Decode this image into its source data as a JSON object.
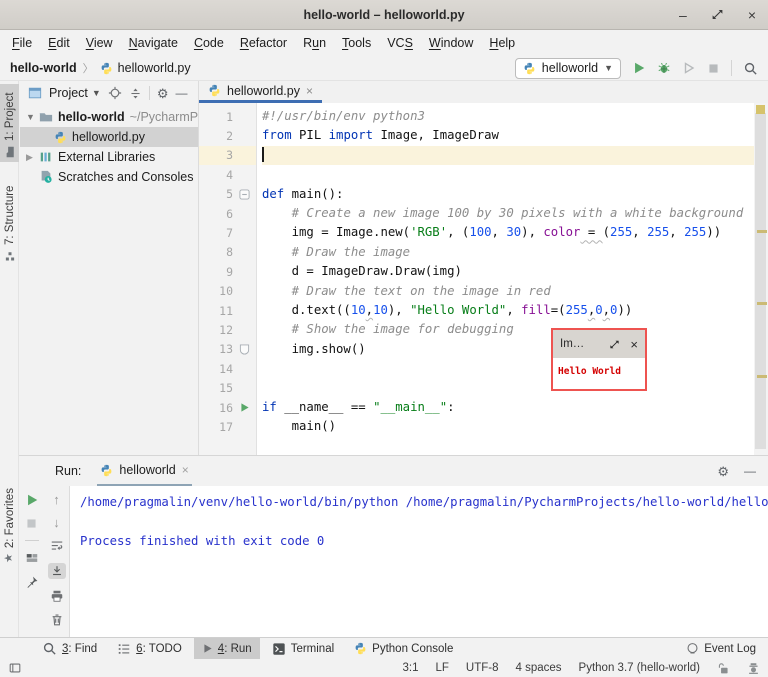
{
  "window": {
    "title": "hello-world – helloworld.py"
  },
  "menu": {
    "items": [
      {
        "label": "File",
        "u": 0
      },
      {
        "label": "Edit",
        "u": 0
      },
      {
        "label": "View",
        "u": 0
      },
      {
        "label": "Navigate",
        "u": 0
      },
      {
        "label": "Code",
        "u": 0
      },
      {
        "label": "Refactor",
        "u": 0
      },
      {
        "label": "Run",
        "u": 1
      },
      {
        "label": "Tools",
        "u": 0
      },
      {
        "label": "VCS",
        "u": 2
      },
      {
        "label": "Window",
        "u": 0
      },
      {
        "label": "Help",
        "u": 0
      }
    ]
  },
  "navbar": {
    "breadcrumb_project": "hello-world",
    "breadcrumb_file": "helloworld.py",
    "run_config": "helloworld"
  },
  "left_strip": {
    "project_tab": "1: Project",
    "structure_tab": "7: Structure",
    "favorites_tab": "2: Favorites"
  },
  "project_panel": {
    "title": "Project",
    "tree": [
      {
        "arrow": "down",
        "icon": "folder",
        "label": "hello-world",
        "suffix": "~/PycharmPr",
        "bold": true,
        "child": false,
        "selected": false
      },
      {
        "arrow": "",
        "icon": "python",
        "label": "helloworld.py",
        "suffix": "",
        "bold": false,
        "child": true,
        "selected": true
      },
      {
        "arrow": "right",
        "icon": "library",
        "label": "External Libraries",
        "suffix": "",
        "bold": false,
        "child": false,
        "selected": false
      },
      {
        "arrow": "",
        "icon": "scratches",
        "label": "Scratches and Consoles",
        "suffix": "",
        "bold": false,
        "child": false,
        "selected": false
      }
    ]
  },
  "editor": {
    "tab_label": "helloworld.py",
    "lines": [
      {
        "n": 1,
        "tokens": [
          [
            "com",
            "#!/usr/bin/env python3"
          ]
        ]
      },
      {
        "n": 2,
        "tokens": [
          [
            "kw",
            "from"
          ],
          [
            "pl",
            " PIL "
          ],
          [
            "kw",
            "import"
          ],
          [
            "pl",
            " Image, ImageDraw"
          ]
        ]
      },
      {
        "n": 3,
        "tokens": [],
        "cursor": true,
        "highlight": true
      },
      {
        "n": 4,
        "tokens": []
      },
      {
        "n": 5,
        "tokens": [
          [
            "kw",
            "def"
          ],
          [
            "pl",
            " main():"
          ]
        ],
        "fold": "minus"
      },
      {
        "n": 6,
        "tokens": [
          [
            "pl",
            "    "
          ],
          [
            "com",
            "# Create a new image 100 by 30 pixels with a white background"
          ]
        ]
      },
      {
        "n": 7,
        "tokens": [
          [
            "pl",
            "    img = Image.new("
          ],
          [
            "str",
            "'RGB'"
          ],
          [
            "pl",
            ", ("
          ],
          [
            "num",
            "100"
          ],
          [
            "pl",
            ", "
          ],
          [
            "num",
            "30"
          ],
          [
            "pl",
            "), "
          ],
          [
            "par",
            "color"
          ],
          [
            "wv",
            " = "
          ],
          [
            "pl",
            "("
          ],
          [
            "num",
            "255"
          ],
          [
            "pl",
            ", "
          ],
          [
            "num",
            "255"
          ],
          [
            "pl",
            ", "
          ],
          [
            "num",
            "255"
          ],
          [
            "pl",
            "))"
          ]
        ]
      },
      {
        "n": 8,
        "tokens": [
          [
            "pl",
            "    "
          ],
          [
            "com",
            "# Draw the image"
          ]
        ]
      },
      {
        "n": 9,
        "tokens": [
          [
            "pl",
            "    d = ImageDraw.Draw(img)"
          ]
        ]
      },
      {
        "n": 10,
        "tokens": [
          [
            "pl",
            "    "
          ],
          [
            "com",
            "# Draw the text on the image in red"
          ]
        ]
      },
      {
        "n": 11,
        "tokens": [
          [
            "pl",
            "    d.text(("
          ],
          [
            "num",
            "10"
          ],
          [
            "wv",
            ","
          ],
          [
            "num",
            "10"
          ],
          [
            "pl",
            "), "
          ],
          [
            "str",
            "\"Hello World\""
          ],
          [
            "pl",
            ", "
          ],
          [
            "par",
            "fill"
          ],
          [
            "pl",
            "=("
          ],
          [
            "num",
            "255"
          ],
          [
            "wv",
            ","
          ],
          [
            "num",
            "0"
          ],
          [
            "wv",
            ","
          ],
          [
            "num",
            "0"
          ],
          [
            "pl",
            "))"
          ]
        ]
      },
      {
        "n": 12,
        "tokens": [
          [
            "pl",
            "    "
          ],
          [
            "com",
            "# Show the image for debugging"
          ]
        ]
      },
      {
        "n": 13,
        "tokens": [
          [
            "pl",
            "    img.show()"
          ]
        ],
        "fold": "end"
      },
      {
        "n": 14,
        "tokens": []
      },
      {
        "n": 15,
        "tokens": []
      },
      {
        "n": 16,
        "tokens": [
          [
            "kw",
            "if"
          ],
          [
            "pl",
            " __name__ == "
          ],
          [
            "str",
            "\"__main__\""
          ],
          [
            "pl",
            ":"
          ]
        ],
        "run": true
      },
      {
        "n": 17,
        "tokens": [
          [
            "pl",
            "    main()"
          ]
        ]
      }
    ]
  },
  "popup": {
    "title": "Im…",
    "text": "Hello World"
  },
  "run_panel": {
    "label": "Run:",
    "tab_label": "helloworld",
    "console": [
      "/home/pragmalin/venv/hello-world/bin/python /home/pragmalin/PycharmProjects/hello-world/helloworld.py",
      "",
      "Process finished with exit code 0"
    ]
  },
  "bottom_bar": {
    "items": [
      {
        "icon": "search",
        "label": "3: Find",
        "u": 0,
        "active": false
      },
      {
        "icon": "todo",
        "label": "6: TODO",
        "u": 0,
        "active": false
      },
      {
        "icon": "playgray",
        "label": "4: Run",
        "u": 0,
        "active": true
      },
      {
        "icon": "terminal",
        "label": "Terminal",
        "u": -1,
        "active": false
      },
      {
        "icon": "python",
        "label": "Python Console",
        "u": -1,
        "active": false
      }
    ],
    "event_log": "Event Log"
  },
  "status_bar": {
    "items": [
      "3:1",
      "LF",
      "UTF-8",
      "4 spaces",
      "Python 3.7 (hello-world)"
    ]
  },
  "colors": {
    "accent_blue": "#3e6eb3",
    "keyword": "#0033b3",
    "string": "#067d17",
    "number": "#1750eb",
    "comment": "#8c8c8c",
    "parameter": "#871094",
    "console_text": "#2832cc",
    "run_green": "#59a869",
    "popup_border": "#ee5350",
    "popup_text": "#d40000"
  }
}
